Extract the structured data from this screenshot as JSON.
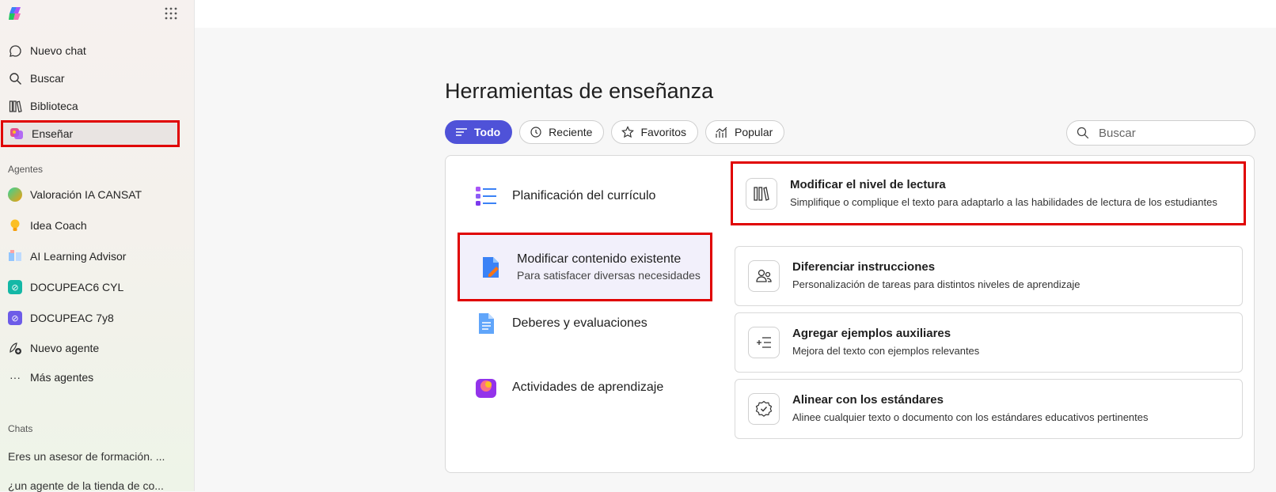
{
  "sidebar": {
    "nav": [
      {
        "label": "Nuevo chat",
        "icon": "chat-bubble-icon"
      },
      {
        "label": "Buscar",
        "icon": "search-icon"
      },
      {
        "label": "Biblioteca",
        "icon": "library-icon"
      },
      {
        "label": "Enseñar",
        "icon": "teach-icon",
        "active": true
      }
    ],
    "agents_label": "Agentes",
    "agents": [
      {
        "label": "Valoración IA CANSAT",
        "icon": "agent-globe-icon"
      },
      {
        "label": "Idea Coach",
        "icon": "lightbulb-icon"
      },
      {
        "label": "AI Learning Advisor",
        "icon": "book-icon"
      },
      {
        "label": "DOCUPEAC6 CYL",
        "icon": "agent-teal-icon"
      },
      {
        "label": "DOCUPEAC 7y8",
        "icon": "agent-purple-icon"
      },
      {
        "label": "Nuevo agente",
        "icon": "new-agent-icon"
      },
      {
        "label": "Más agentes",
        "icon": "more-icon"
      }
    ],
    "chats_label": "Chats",
    "chats": [
      "Eres un asesor de formación. ...",
      "¿un agente de la tienda de co..."
    ]
  },
  "main": {
    "title": "Herramientas de enseñanza",
    "filters": [
      {
        "label": "Todo",
        "icon": "list-icon",
        "active": true
      },
      {
        "label": "Reciente",
        "icon": "history-icon"
      },
      {
        "label": "Favoritos",
        "icon": "star-icon"
      },
      {
        "label": "Popular",
        "icon": "trending-icon"
      }
    ],
    "search_placeholder": "Buscar",
    "categories": [
      {
        "title": "Planificación del currículo",
        "icon": "list-bullets-icon"
      },
      {
        "title": "Modificar contenido existente",
        "subtitle": "Para satisfacer diversas necesidades",
        "icon": "edit-document-icon",
        "selected": true
      },
      {
        "title": "Deberes y evaluaciones",
        "icon": "document-icon"
      },
      {
        "title": "Actividades de aprendizaje",
        "icon": "activities-icon"
      }
    ],
    "tools": [
      {
        "title": "Modificar el nivel de lectura",
        "desc": "Simplifique o complique el texto para adaptarlo a las habilidades de lectura de los estudiantes",
        "icon": "books-icon"
      },
      {
        "title": "Diferenciar instrucciones",
        "desc": "Personalización de tareas para distintos niveles de aprendizaje",
        "icon": "people-icon"
      },
      {
        "title": "Agregar ejemplos auxiliares",
        "desc": "Mejora del texto con ejemplos relevantes",
        "icon": "add-text-icon"
      },
      {
        "title": "Alinear con los estándares",
        "desc": "Alinee cualquier texto o documento con los estándares educativos pertinentes",
        "icon": "badge-check-icon"
      }
    ]
  },
  "colors": {
    "accent": "#4f52d8",
    "highlight": "#e00000"
  }
}
